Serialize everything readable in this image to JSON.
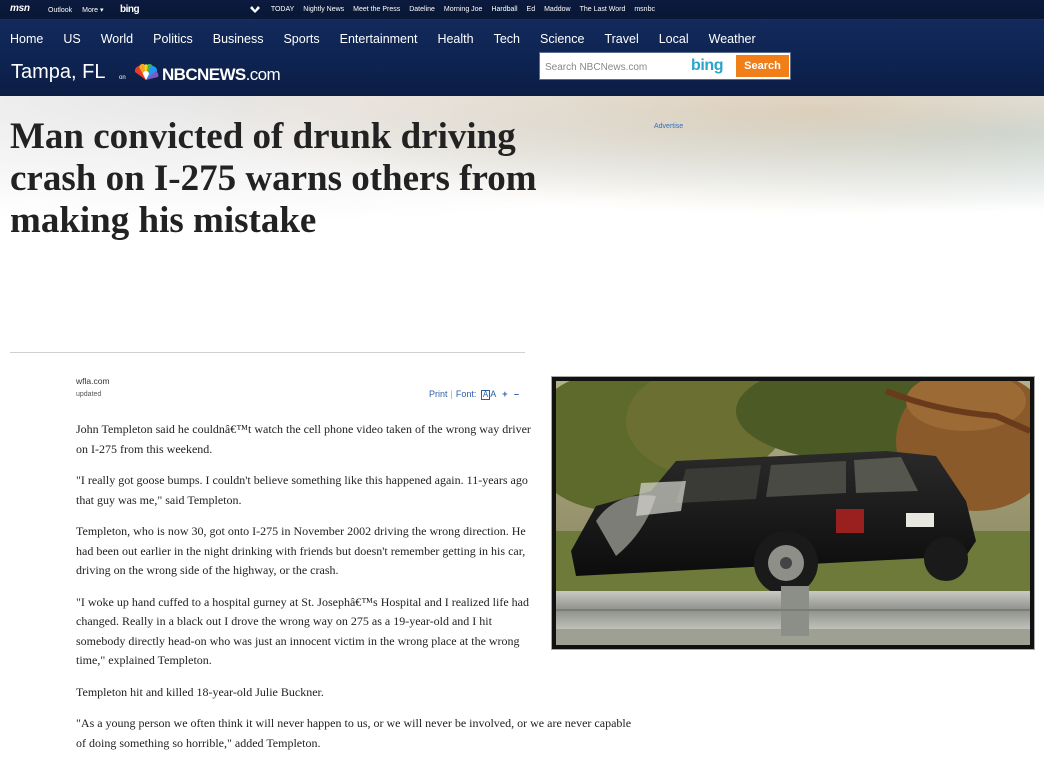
{
  "utility_bar": {
    "msn": "msn",
    "links": [
      "Outlook",
      "More ▾"
    ],
    "bing": "bing",
    "shows": [
      "TODAY",
      "Nightly News",
      "Meet the Press",
      "Dateline",
      "Morning Joe",
      "Hardball",
      "Ed",
      "Maddow",
      "The Last Word",
      "msnbc"
    ]
  },
  "nav": {
    "items": [
      "Home",
      "US",
      "World",
      "Politics",
      "Business",
      "Sports",
      "Entertainment",
      "Health",
      "Tech",
      "Science",
      "Travel",
      "Local",
      "Weather"
    ],
    "location": "Tampa, FL",
    "on": "on",
    "logo_main": "NBCNEWS",
    "logo_suffix": ".com"
  },
  "search": {
    "placeholder": "Search NBCNews.com",
    "provider": "bing",
    "button": "Search"
  },
  "advertise": "Advertise",
  "article": {
    "headline": "Man convicted of drunk driving crash on I-275 warns others from making his mistake",
    "source": "wfla.com",
    "updated": "updated",
    "tools": {
      "print": "Print",
      "font": "Font:",
      "font_glyph": "A",
      "font_a": "A",
      "plus": "+",
      "minus": "–"
    },
    "paragraphs": [
      "John Templeton said he couldnâ€™t watch the cell phone video taken of the wrong way driver on I-275 from this weekend.",
      "\"I really got goose bumps. I couldn't believe something like this happened again. 11-years ago that guy was me,\" said Templeton.",
      "Templeton, who is now 30, got onto I-275 in November 2002 driving the wrong direction. He had been out earlier in the night drinking with friends but doesn't remember getting in his car, driving on the wrong side of the highway, or the crash.",
      "\"I woke up hand cuffed to a hospital gurney at St. Josephâ€™s Hospital and I realized life had changed. Really in a black out I drove the wrong way on 275 as a 19-year-old and I hit somebody directly head-on who was just an innocent victim in the wrong place at the wrong time,\" explained Templeton.",
      "Templeton hit and killed 18-year-old Julie Buckner.",
      "\"As a young person we often think it will never happen to us, or we will never be involved, or we are never capable of doing something so horrible,\" added Templeton."
    ]
  },
  "colors": {
    "nav_bg": "#0e2452",
    "search_button": "#f07f1a",
    "link": "#2b5fa6"
  }
}
